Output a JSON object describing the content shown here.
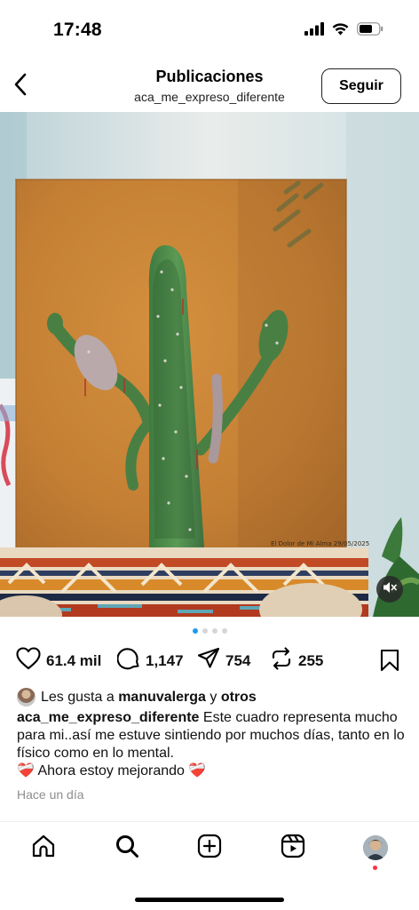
{
  "status_bar": {
    "time": "17:48",
    "icons": [
      "cellular-signal-icon",
      "wifi-icon",
      "battery-icon"
    ]
  },
  "header": {
    "title": "Publicaciones",
    "username": "aca_me_expreso_diferente",
    "follow_label": "Seguir",
    "back_icon": "chevron-left-icon"
  },
  "post": {
    "image": {
      "description_icon": "cactus-painting-image",
      "painting_signature": "El Dolor de Mi Alma 29/05/2025",
      "mute_icon": "speaker-muted-icon"
    },
    "carousel": {
      "count": 4,
      "active_index": 0
    },
    "actions": {
      "likes": "61.4 mil",
      "comments": "1,147",
      "shares": "754",
      "reposts": "255"
    },
    "liked_by": {
      "prefix": "Les gusta a",
      "user": "manuvalerga",
      "connector": "y",
      "others": "otros"
    },
    "caption": {
      "username": "aca_me_expreso_diferente",
      "text": "Este cuadro representa mucho para mi..así me estuve sintiendo por muchos días, tanto en lo físico como en lo mental.",
      "line2": "Ahora estoy mejorando",
      "emoji": "❤️‍🩹"
    },
    "timestamp": "Hace un día"
  },
  "tab_bar": {
    "items": [
      "home-icon",
      "search-icon",
      "create-post-icon",
      "reels-icon",
      "profile-avatar"
    ]
  },
  "colors": {
    "accent": "#1d9bf0",
    "notification": "#ff3040",
    "muted_text": "#8e8e8e"
  }
}
